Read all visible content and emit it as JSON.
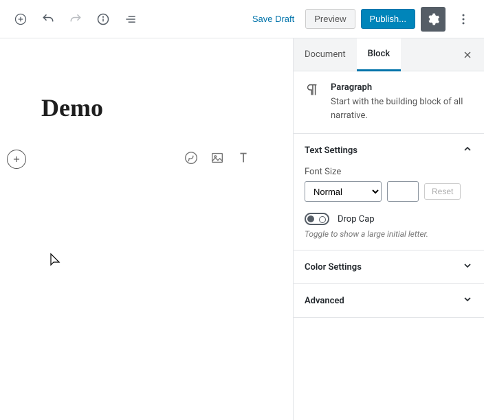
{
  "toolbar": {
    "save_draft": "Save Draft",
    "preview": "Preview",
    "publish": "Publish..."
  },
  "editor": {
    "title": "Demo"
  },
  "sidebar": {
    "tabs": {
      "document": "Document",
      "block": "Block"
    },
    "block_info": {
      "title": "Paragraph",
      "desc": "Start with the building block of all narrative."
    },
    "text_settings": {
      "header": "Text Settings",
      "font_size_label": "Font Size",
      "font_size_value": "Normal",
      "reset": "Reset",
      "drop_cap_label": "Drop Cap",
      "drop_cap_hint": "Toggle to show a large initial letter."
    },
    "color_settings": {
      "header": "Color Settings"
    },
    "advanced": {
      "header": "Advanced"
    }
  }
}
